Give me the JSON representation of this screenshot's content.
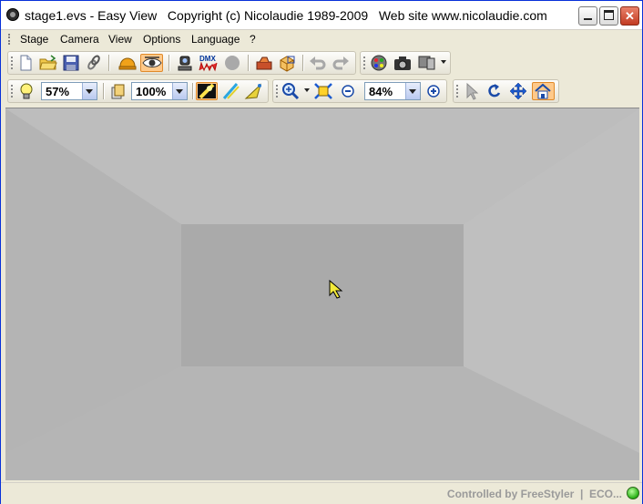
{
  "window": {
    "title": "stage1.evs - Easy View   Copyright (c) Nicolaudie 1989-2009   Web site www.nicolaudie.com",
    "minimize_glyph": "",
    "maximize_glyph": "",
    "close_glyph": "✕"
  },
  "menu": {
    "items": [
      {
        "label": "Stage"
      },
      {
        "label": "Camera"
      },
      {
        "label": "View"
      },
      {
        "label": "Options"
      },
      {
        "label": "Language"
      },
      {
        "label": "?"
      }
    ]
  },
  "toolbar1": {
    "dmx_label": "DMX"
  },
  "toolbar2": {
    "light_intensity": "57%",
    "object_opacity": "100%",
    "zoom_level": "84%"
  },
  "status": {
    "text": "Controlled by FreeStyler  |  ECO...",
    "led_color": "#28b014"
  }
}
